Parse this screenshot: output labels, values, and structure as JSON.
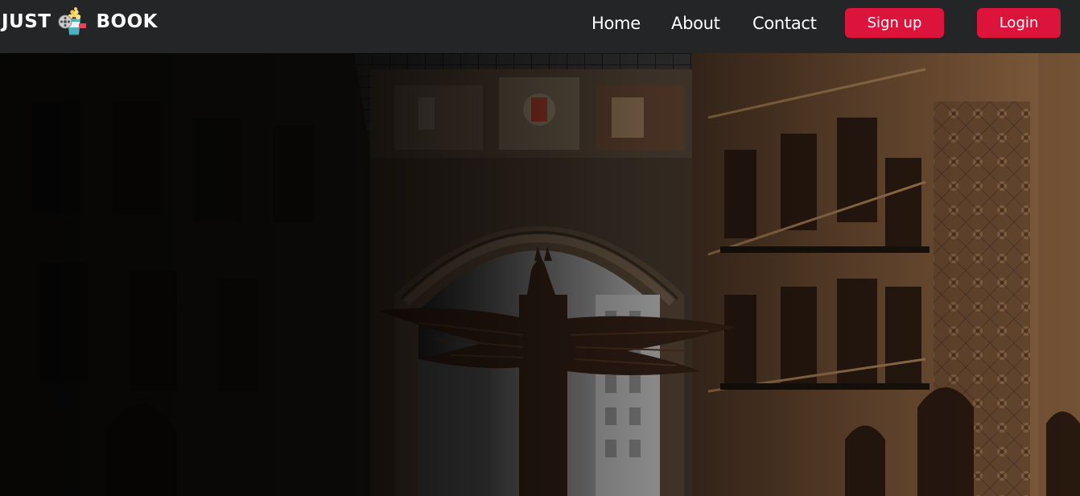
{
  "brand": {
    "left_word": "JUST",
    "right_word": "BOOK",
    "logo_icon": "popcorn-film-reel-icon"
  },
  "nav": {
    "links": [
      "Home",
      "About",
      "Contact"
    ],
    "signup_label": "Sign up",
    "login_label": "Login"
  },
  "colors": {
    "navbar_bg": "#242526",
    "button_accent": "#dc143c",
    "text": "#ffffff"
  },
  "hero": {
    "image_subject": "winged-horse-statue-in-arcade-gallery"
  }
}
